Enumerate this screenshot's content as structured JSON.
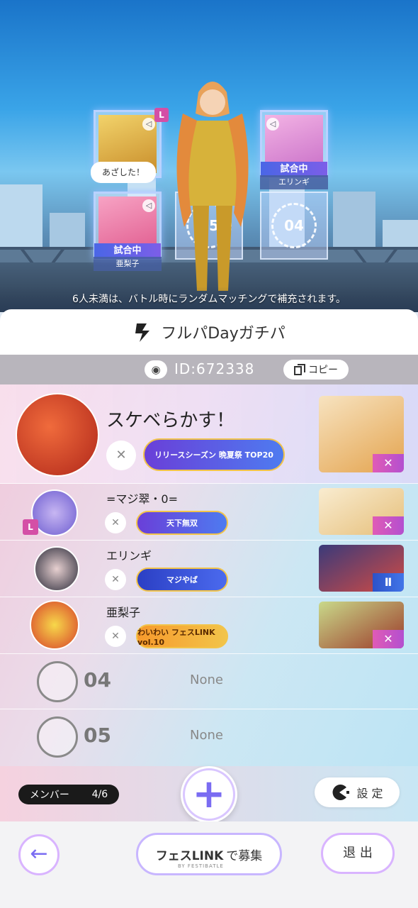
{
  "stage": {
    "bubble_text": "あざした！",
    "lead_tag": "L",
    "slots": [
      {
        "status": "",
        "name": ""
      },
      {
        "status": "試合中",
        "name": "亜梨子"
      },
      {
        "status": "試合中",
        "name": "エリンギ"
      }
    ],
    "empty_slots": [
      "05",
      "04"
    ],
    "notice": "6人未満は、バトル時にランダムマッチングで補充されます。"
  },
  "party": {
    "title": "フルパDayガチパ",
    "id_text": "ID:672338",
    "copy_label": "コピー"
  },
  "members": [
    {
      "name": "スケベらかす！",
      "title_plate": "リリースシーズン 晩夏祭 TOP20",
      "leader": true,
      "badge": ""
    },
    {
      "name": "=マジ翠・0=",
      "title_plate": "天下無双",
      "leader": false,
      "badge": "L"
    },
    {
      "name": "エリンギ",
      "title_plate": "マジやば",
      "leader": false,
      "badge": ""
    },
    {
      "name": "亜梨子",
      "title_plate": "わいわい フェスLINK vol.10",
      "leader": false,
      "badge": ""
    }
  ],
  "empty_rows": [
    {
      "num": "04",
      "text": "None"
    },
    {
      "num": "05",
      "text": "None"
    }
  ],
  "controls": {
    "member_label": "メンバー",
    "member_count": "4/6",
    "settings_label": "設 定"
  },
  "footer": {
    "recruit_brand": "フェスLINK",
    "recruit_sub": "BY FESTIBATLE",
    "recruit_action": "で募集",
    "exit_label": "退 出"
  },
  "colors": {
    "accent": "#7a6cf2",
    "lead_pink": "#d44fa6",
    "match_blue": "#4a66e6"
  }
}
